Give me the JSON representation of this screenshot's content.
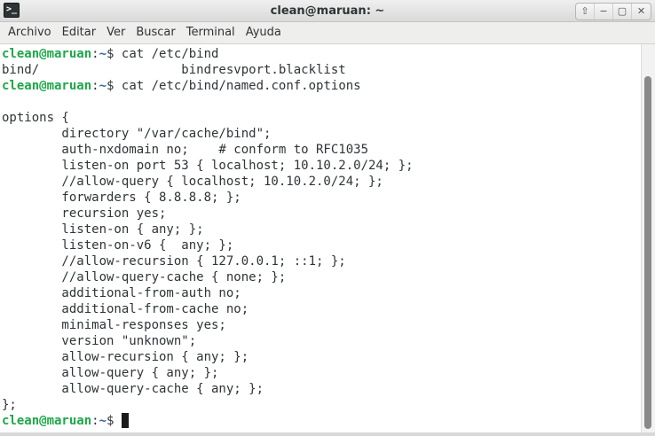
{
  "window": {
    "title": "clean@maruan: ~",
    "app_icon": "terminal-icon",
    "app_icon_glyph": ">_",
    "controls": {
      "up_glyph": "⇧",
      "minimize_glyph": "−",
      "maximize_glyph": "▢",
      "close_glyph": "✕"
    }
  },
  "menu": {
    "items": [
      "Archivo",
      "Editar",
      "Ver",
      "Buscar",
      "Terminal",
      "Ayuda"
    ]
  },
  "terminal": {
    "prompt": {
      "user_host": "clean@maruan",
      "separator": ":",
      "path": "~",
      "symbol": "$ "
    },
    "lines": [
      {
        "kind": "prompt",
        "text": "cat /etc/bind"
      },
      {
        "kind": "output",
        "text": "bind/                   bindresvport.blacklist"
      },
      {
        "kind": "prompt",
        "text": "cat /etc/bind/named.conf.options"
      },
      {
        "kind": "output",
        "text": ""
      },
      {
        "kind": "output",
        "text": "options {"
      },
      {
        "kind": "output",
        "text": "        directory \"/var/cache/bind\";"
      },
      {
        "kind": "output",
        "text": "        auth-nxdomain no;    # conform to RFC1035"
      },
      {
        "kind": "output",
        "text": "        listen-on port 53 { localhost; 10.10.2.0/24; };"
      },
      {
        "kind": "output",
        "text": "        //allow-query { localhost; 10.10.2.0/24; };"
      },
      {
        "kind": "output",
        "text": "        forwarders { 8.8.8.8; };"
      },
      {
        "kind": "output",
        "text": "        recursion yes;"
      },
      {
        "kind": "output",
        "text": "        listen-on { any; };"
      },
      {
        "kind": "output",
        "text": "        listen-on-v6 {  any; };"
      },
      {
        "kind": "output",
        "text": "        //allow-recursion { 127.0.0.1; ::1; };"
      },
      {
        "kind": "output",
        "text": "        //allow-query-cache { none; };"
      },
      {
        "kind": "output",
        "text": "        additional-from-auth no;"
      },
      {
        "kind": "output",
        "text": "        additional-from-cache no;"
      },
      {
        "kind": "output",
        "text": "        minimal-responses yes;"
      },
      {
        "kind": "output",
        "text": "        version \"unknown\";"
      },
      {
        "kind": "output",
        "text": "        allow-recursion { any; };"
      },
      {
        "kind": "output",
        "text": "        allow-query { any; };"
      },
      {
        "kind": "output",
        "text": "        allow-query-cache { any; };"
      },
      {
        "kind": "output",
        "text": "};"
      },
      {
        "kind": "prompt",
        "text": "",
        "cursor": true
      }
    ]
  },
  "colors": {
    "prompt_user": "#1fa84a",
    "prompt_path": "#3465a4",
    "text": "#2e3436",
    "background": "#ffffff"
  }
}
